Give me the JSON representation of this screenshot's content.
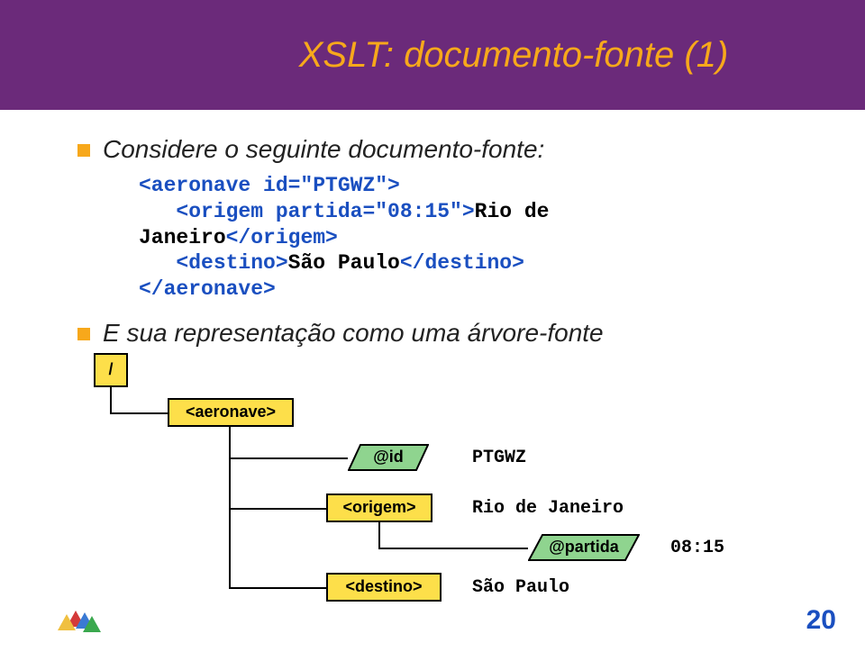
{
  "title": "XSLT: documento-fonte (1)",
  "bullet1": "Considere o seguinte documento-fonte:",
  "code": {
    "l1a": "<aeronave id=\"PTGWZ\">",
    "l2a": "   <origem partida=\"08:15\">",
    "l2b": "Rio de",
    "l3a": "Janeiro",
    "l3b": "</origem>",
    "l4a": "   <destino>",
    "l4b": "São Paulo",
    "l4c": "</destino>",
    "l5a": "</aeronave>"
  },
  "bullet2": "E sua representação como uma árvore-fonte",
  "diagram": {
    "root": "/",
    "aeronave": "<aeronave>",
    "id_attr": "@id",
    "id_val": "PTGWZ",
    "origem": "<origem>",
    "origem_val": "Rio de Janeiro",
    "partida_attr": "@partida",
    "partida_val": "08:15",
    "destino": "<destino>",
    "destino_val": "São Paulo"
  },
  "page_num": "20"
}
